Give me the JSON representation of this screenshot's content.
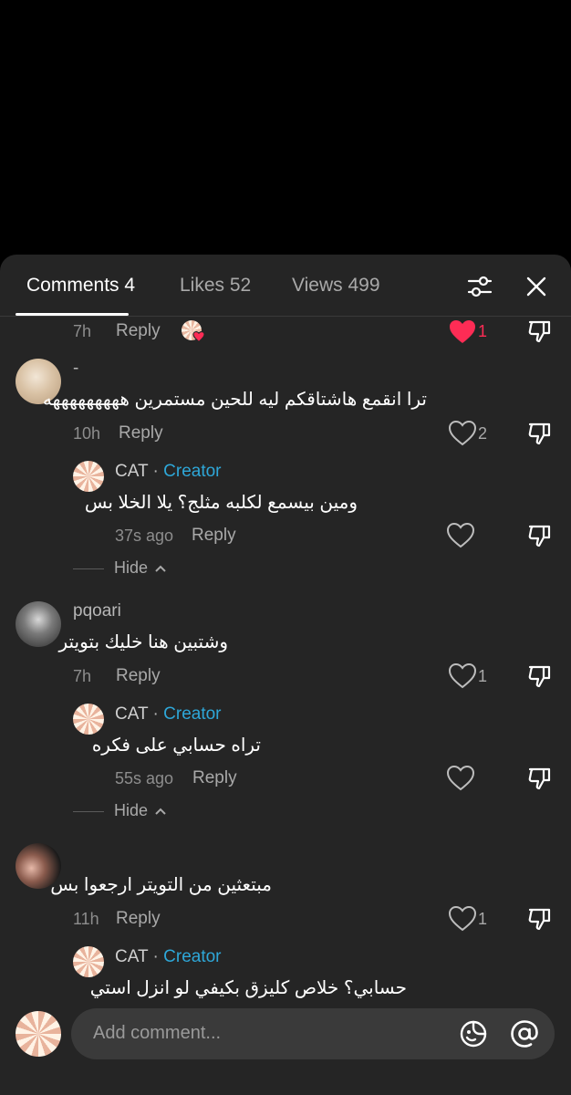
{
  "tabs": {
    "comments": "Comments 4",
    "likes": "Likes 52",
    "views": "Views 499"
  },
  "icons": {
    "filter": "sliders-icon",
    "close": "close-icon",
    "heart": "heart-icon",
    "dislike": "thumbs-down-icon",
    "emoji": "emoji-icon",
    "mention": "at-icon"
  },
  "colors": {
    "sheet": "#252525",
    "creator": "#2ea7d8",
    "liked": "#fe2c55"
  },
  "first_row": {
    "time": "7h",
    "reply": "Reply",
    "likes": "1"
  },
  "comments": [
    {
      "username": "-",
      "text": "ترا انقمع هاشتاقكم ليه للحين مستمرين هههههههههه",
      "time": "10h",
      "reply": "Reply",
      "likes": "2",
      "creator_reply": {
        "username": "CAT",
        "sep": "·",
        "creator": "Creator",
        "text": "ومين بيسمع لكلبه مثلج؟ يلا الخلا بس",
        "time": "37s ago",
        "reply": "Reply"
      },
      "hide": "Hide"
    },
    {
      "username": "pqoari",
      "text": "وشتبين هنا خليك بتويتر",
      "time": "7h",
      "reply": "Reply",
      "likes": "1",
      "creator_reply": {
        "username": "CAT",
        "sep": "·",
        "creator": "Creator",
        "text": "تراه حسابي على فكره",
        "time": "55s ago",
        "reply": "Reply"
      },
      "hide": "Hide"
    },
    {
      "username": "",
      "text": "مبتعثين من التويتر ارجعوا بس",
      "time": "11h",
      "reply": "Reply",
      "likes": "1",
      "creator_reply": {
        "username": "CAT",
        "sep": "·",
        "creator": "Creator",
        "text": "حسابي؟ خلاص كليزق بكيفي لو انزل استي"
      }
    }
  ],
  "input": {
    "placeholder": "Add comment..."
  }
}
